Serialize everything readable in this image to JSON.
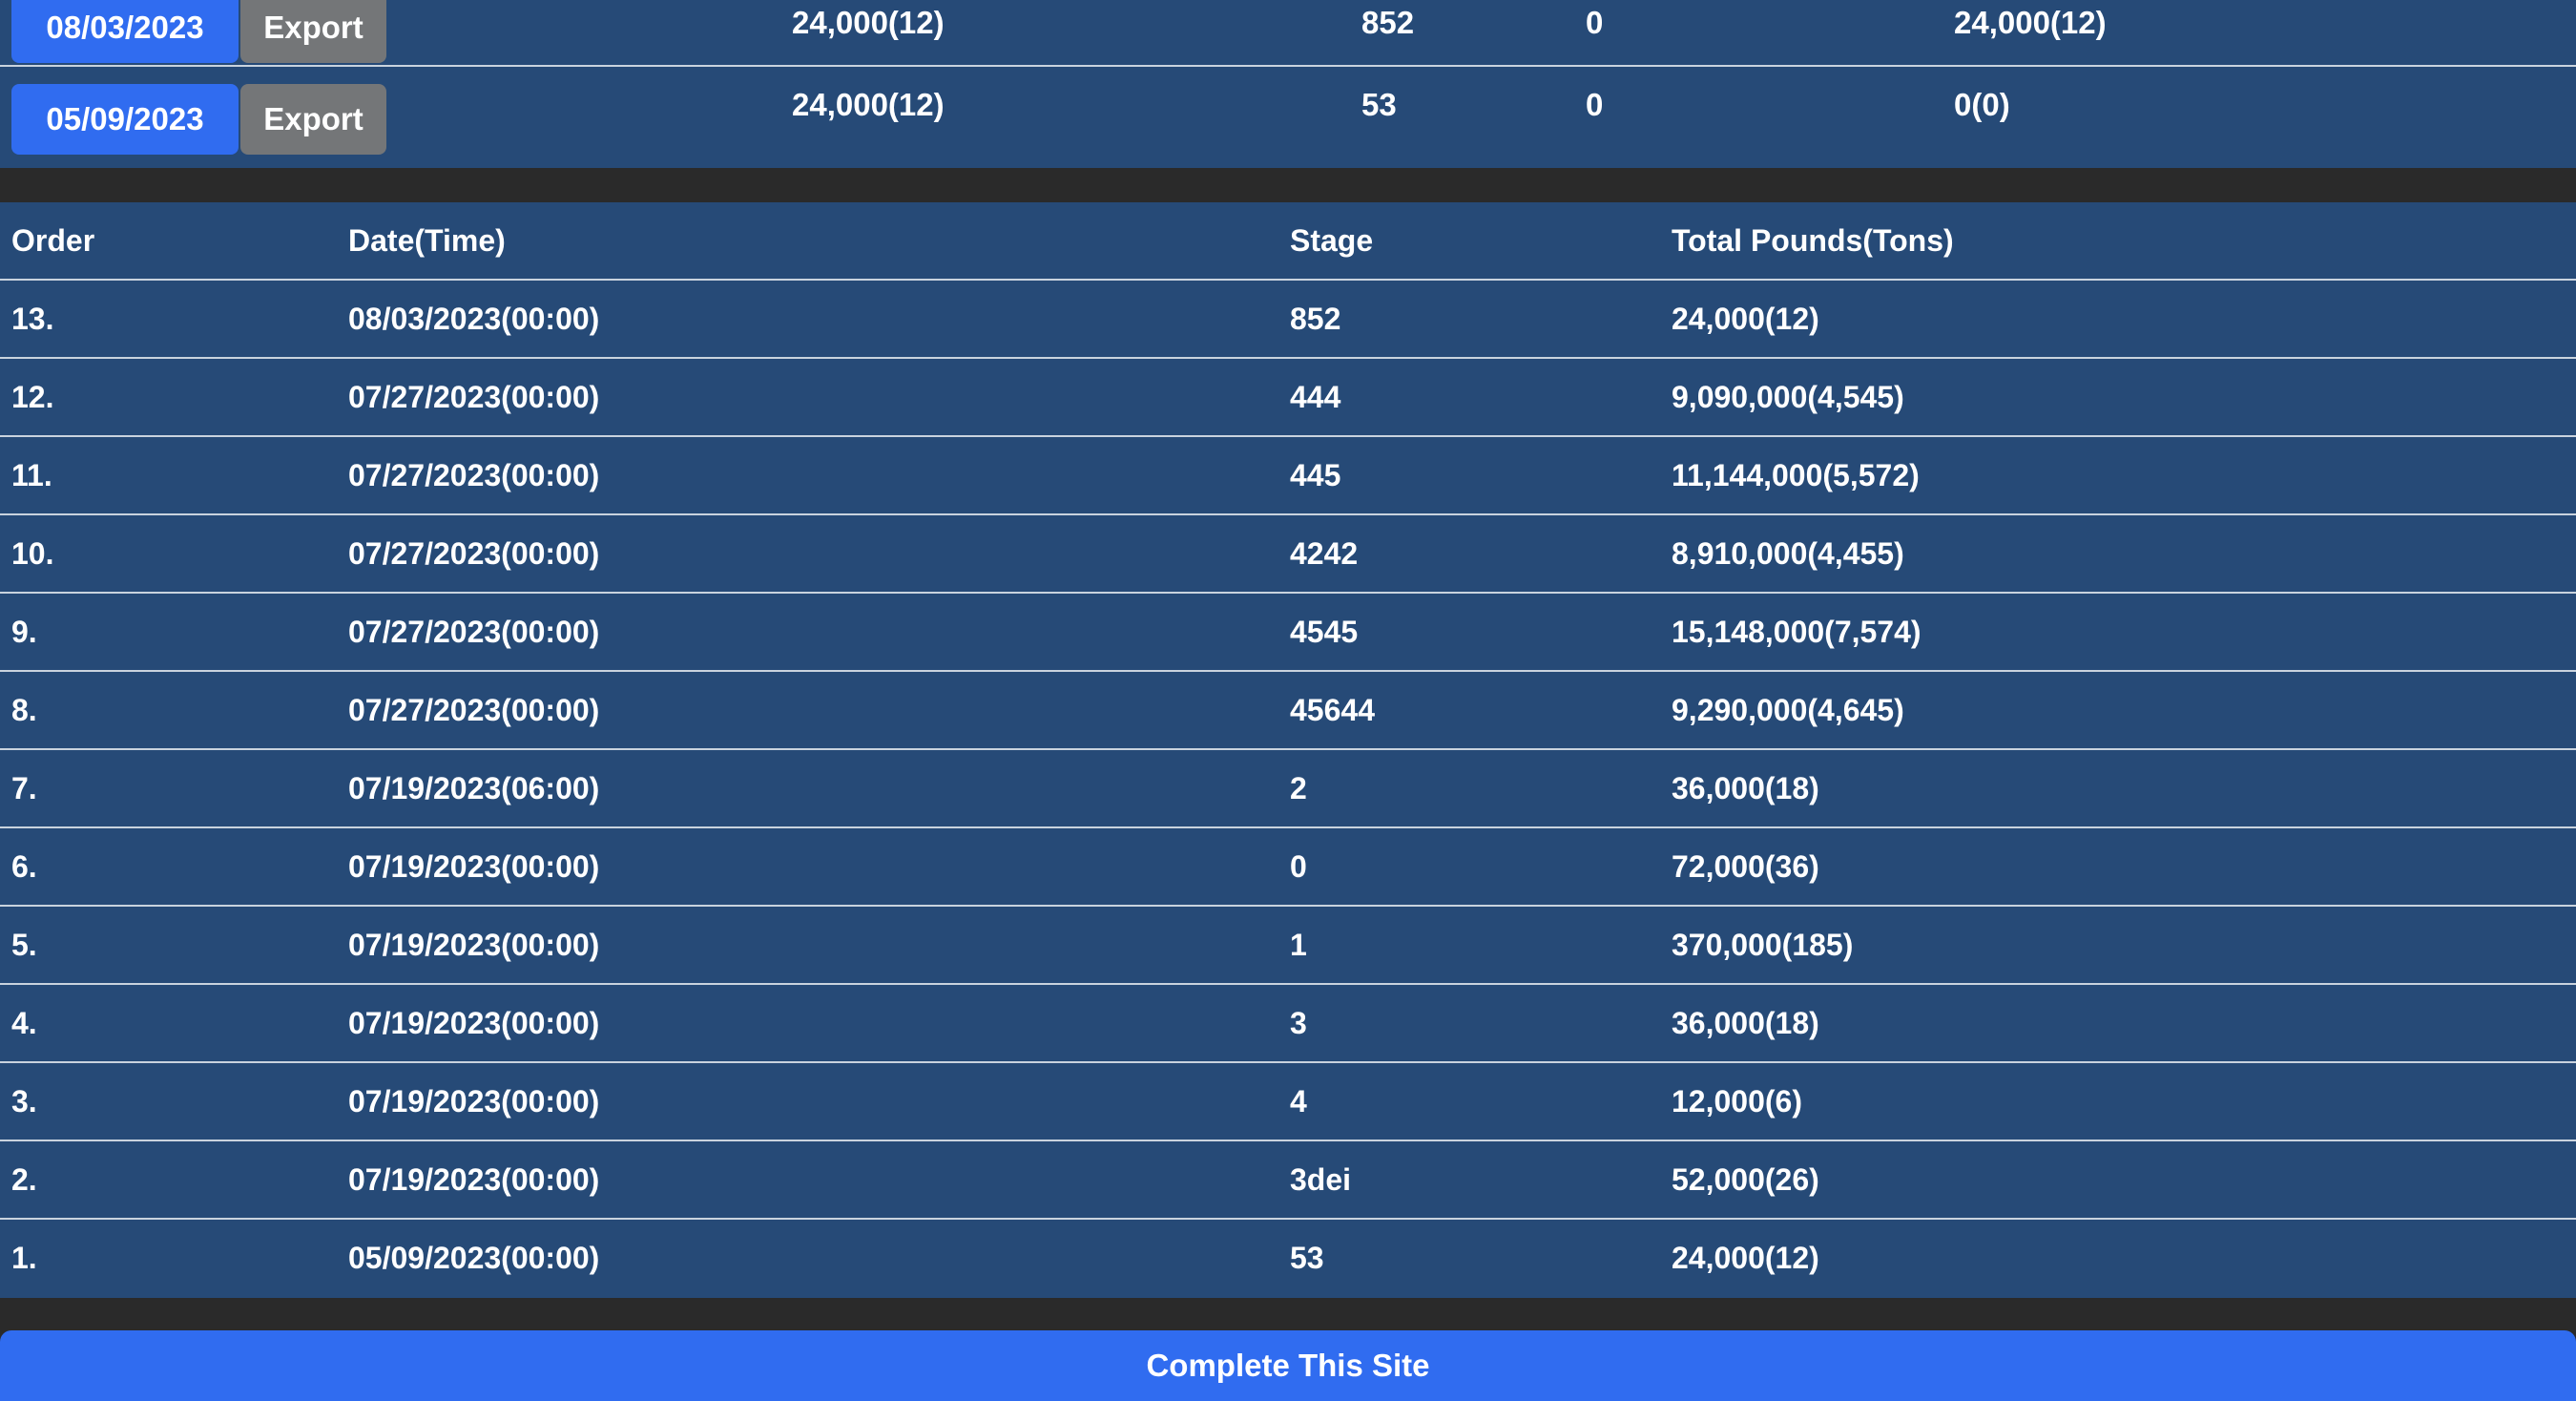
{
  "summary": {
    "rows": [
      {
        "date": "08/03/2023",
        "export_label": "Export",
        "total": "24,000(12)",
        "stage": "852",
        "zero": "0",
        "remaining": "24,000(12)"
      },
      {
        "date": "05/09/2023",
        "export_label": "Export",
        "total": "24,000(12)",
        "stage": "53",
        "zero": "0",
        "remaining": "0(0)"
      }
    ]
  },
  "orders": {
    "headers": {
      "order": "Order",
      "date": "Date(Time)",
      "stage": "Stage",
      "total": "Total Pounds(Tons)"
    },
    "rows": [
      {
        "order": "13.",
        "date": "08/03/2023(00:00)",
        "stage": "852",
        "total": "24,000(12)"
      },
      {
        "order": "12.",
        "date": "07/27/2023(00:00)",
        "stage": "444",
        "total": "9,090,000(4,545)"
      },
      {
        "order": "11.",
        "date": "07/27/2023(00:00)",
        "stage": "445",
        "total": "11,144,000(5,572)"
      },
      {
        "order": "10.",
        "date": "07/27/2023(00:00)",
        "stage": "4242",
        "total": "8,910,000(4,455)"
      },
      {
        "order": "9.",
        "date": "07/27/2023(00:00)",
        "stage": "4545",
        "total": "15,148,000(7,574)"
      },
      {
        "order": "8.",
        "date": "07/27/2023(00:00)",
        "stage": "45644",
        "total": "9,290,000(4,645)"
      },
      {
        "order": "7.",
        "date": "07/19/2023(06:00)",
        "stage": "2",
        "total": "36,000(18)"
      },
      {
        "order": "6.",
        "date": "07/19/2023(00:00)",
        "stage": "0",
        "total": "72,000(36)"
      },
      {
        "order": "5.",
        "date": "07/19/2023(00:00)",
        "stage": "1",
        "total": "370,000(185)"
      },
      {
        "order": "4.",
        "date": "07/19/2023(00:00)",
        "stage": "3",
        "total": "36,000(18)"
      },
      {
        "order": "3.",
        "date": "07/19/2023(00:00)",
        "stage": "4",
        "total": "12,000(6)"
      },
      {
        "order": "2.",
        "date": "07/19/2023(00:00)",
        "stage": "3dei",
        "total": "52,000(26)"
      },
      {
        "order": "1.",
        "date": "05/09/2023(00:00)",
        "stage": "53",
        "total": "24,000(12)"
      }
    ]
  },
  "footer": {
    "complete_label": "Complete This Site"
  },
  "colors": {
    "panel_bg": "#264a77",
    "page_bg": "#2a2a2a",
    "primary_button": "#306cf0",
    "secondary_button": "#747678",
    "row_divider": "#c9d3de"
  }
}
